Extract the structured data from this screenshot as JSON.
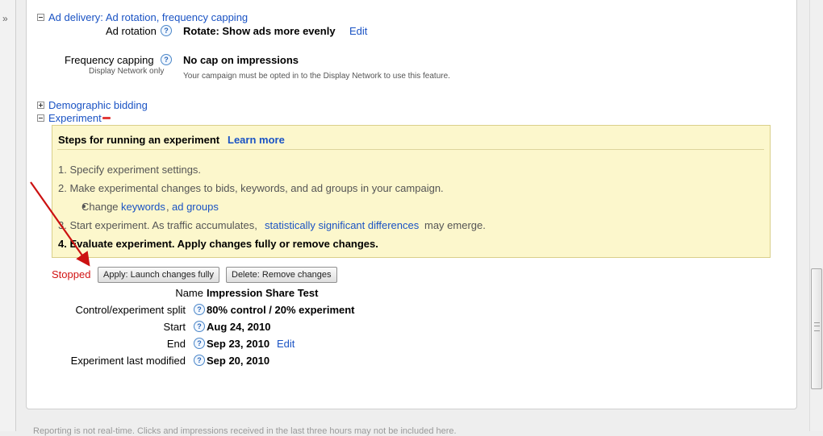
{
  "nav": {
    "collapse_toggle": "»"
  },
  "ad_delivery": {
    "section_title": "Ad delivery: Ad rotation, frequency capping",
    "ad_rotation_label": "Ad rotation",
    "ad_rotation_value": "Rotate: Show ads more evenly",
    "ad_rotation_edit": "Edit",
    "frequency_label": "Frequency capping",
    "frequency_sublabel": "Display Network only",
    "frequency_value": "No cap on impressions",
    "frequency_note": "Your campaign must be opted in to the Display Network to use this feature."
  },
  "demographic_title": "Demographic bidding",
  "experiment": {
    "section_title": "Experiment",
    "steps_title": "Steps for running an experiment",
    "learn_more": "Learn more",
    "step1": "1. Specify experiment settings.",
    "step2": "2. Make experimental changes to bids, keywords, and ad groups in your campaign.",
    "bullet_prefix": "Change",
    "bullet_link_keywords": "keywords",
    "bullet_sep": ",",
    "bullet_link_adgroups": "ad groups",
    "step3_prefix": "3. Start experiment. As traffic accumulates,",
    "step3_link": "statistically significant differences",
    "step3_suffix": "may emerge.",
    "step4": "4. Evaluate experiment. Apply changes fully or remove changes.",
    "status": "Stopped",
    "apply_button": "Apply: Launch changes fully",
    "delete_button": "Delete: Remove changes",
    "details": {
      "name_label": "Name",
      "name_value": "Impression Share Test",
      "split_label": "Control/experiment split",
      "split_value": "80% control / 20% experiment",
      "start_label": "Start",
      "start_value": "Aug 24, 2010",
      "end_label": "End",
      "end_value": "Sep 23, 2010",
      "end_edit": "Edit",
      "modified_label": "Experiment last modified",
      "modified_value": "Sep 20, 2010"
    }
  },
  "help_glyph": "?",
  "footer_note": "Reporting is not real-time. Clicks and impressions received in the last three hours may not be included here.",
  "colors": {
    "link": "#1a53c4",
    "stopped": "#d21414",
    "panel_yellow": "#fcf7cc",
    "arrow": "#cc1111"
  }
}
